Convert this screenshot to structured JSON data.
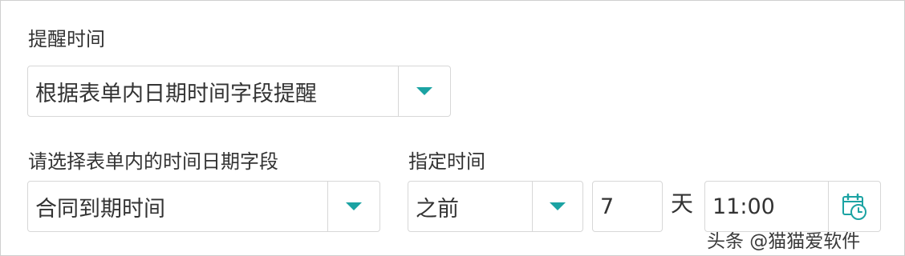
{
  "reminder": {
    "title": "提醒时间",
    "mode_value": "根据表单内日期时间字段提醒"
  },
  "date_field": {
    "label": "请选择表单内的时间日期字段",
    "value": "合同到期时间"
  },
  "specified_time": {
    "label": "指定时间",
    "relation_value": "之前",
    "days_value": "7",
    "days_unit": "天",
    "time_value": "11:00"
  },
  "icons": {
    "dropdown": "chevron-down-icon",
    "clock": "calendar-clock-icon"
  },
  "colors": {
    "accent": "#1ba3a3",
    "border": "#d7d7d7",
    "text": "#333333"
  },
  "watermark": "头条 @猫猫爱软件"
}
